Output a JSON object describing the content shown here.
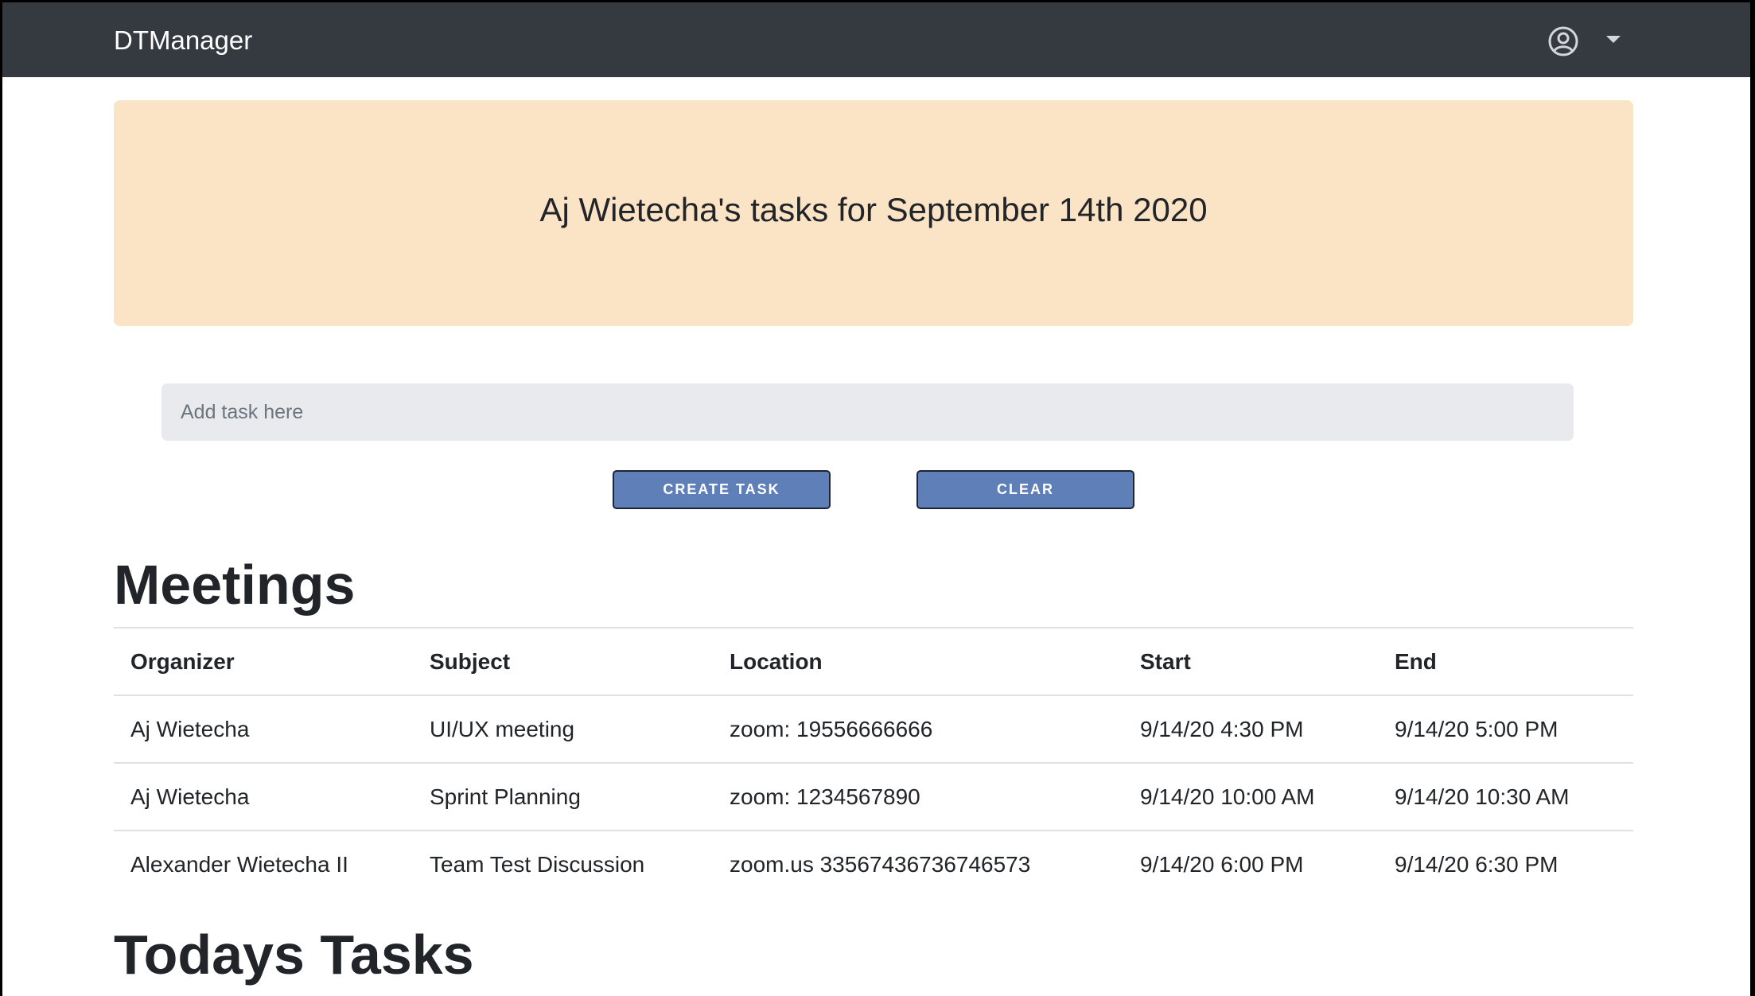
{
  "navbar": {
    "brand": "DTManager",
    "user_icon": "user-circle-icon",
    "menu_icon": "caret-down-icon"
  },
  "jumbotron": {
    "title": "Aj Wietecha's tasks for September 14th 2020"
  },
  "task_form": {
    "placeholder": "Add task here",
    "value": "",
    "create_label": "CREATE TASK",
    "clear_label": "CLEAR"
  },
  "meetings": {
    "heading": "Meetings",
    "columns": [
      "Organizer",
      "Subject",
      "Location",
      "Start",
      "End"
    ],
    "rows": [
      [
        "Aj Wietecha",
        "UI/UX meeting",
        "zoom: 19556666666",
        "9/14/20 4:30 PM",
        "9/14/20 5:00 PM"
      ],
      [
        "Aj Wietecha",
        "Sprint Planning",
        "zoom: 1234567890",
        "9/14/20 10:00 AM",
        "9/14/20 10:30 AM"
      ],
      [
        "Alexander Wietecha II",
        "Team Test Discussion",
        "zoom.us 33567436736746573",
        "9/14/20 6:00 PM",
        "9/14/20 6:30 PM"
      ]
    ]
  },
  "tasks": {
    "heading": "Todays Tasks"
  },
  "colors": {
    "navbar_bg": "#343a40",
    "jumbotron_bg": "#fbe3c5",
    "button_bg": "#5f7fb9",
    "input_bg": "#e9eaed"
  }
}
